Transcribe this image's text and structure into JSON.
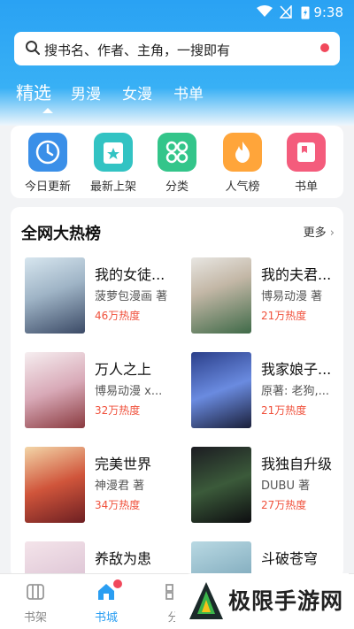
{
  "status": {
    "time": "9:38"
  },
  "search": {
    "placeholder": "搜书名、作者、主角，一搜即有"
  },
  "tabs": [
    "精选",
    "男漫",
    "女漫",
    "书单"
  ],
  "quick": [
    {
      "label": "今日更新",
      "icon": "clock-icon",
      "color": "#3a8fe8"
    },
    {
      "label": "最新上架",
      "icon": "star-shelf-icon",
      "color": "#32c3c3"
    },
    {
      "label": "分类",
      "icon": "grid-icon",
      "color": "#33c58a"
    },
    {
      "label": "人气榜",
      "icon": "flame-icon",
      "color": "#ffa53a"
    },
    {
      "label": "书单",
      "icon": "book-icon",
      "color": "#f45c7c"
    }
  ],
  "hot": {
    "title": "全网大热榜",
    "more": "更多",
    "books": [
      {
        "title": "我的女徒...",
        "author": "菠萝包漫画 著",
        "heat": "46万热度"
      },
      {
        "title": "我的夫君...",
        "author": "博易动漫 著",
        "heat": "21万热度"
      },
      {
        "title": "万人之上",
        "author": "博易动漫 x...",
        "heat": "32万热度"
      },
      {
        "title": "我家娘子...",
        "author": "原著: 老狗,...",
        "heat": "21万热度"
      },
      {
        "title": "完美世界",
        "author": "神漫君 著",
        "heat": "34万热度"
      },
      {
        "title": "我独自升级",
        "author": "DUBU 著",
        "heat": "27万热度"
      },
      {
        "title": "养敌为患",
        "author": "",
        "heat": ""
      },
      {
        "title": "斗破苍穹",
        "author": "",
        "heat": ""
      }
    ]
  },
  "bottom_nav": [
    {
      "label": "书架",
      "active": false
    },
    {
      "label": "书城",
      "active": true
    },
    {
      "label": "分",
      "active": false
    }
  ],
  "watermark": {
    "text": "极限手游网"
  }
}
